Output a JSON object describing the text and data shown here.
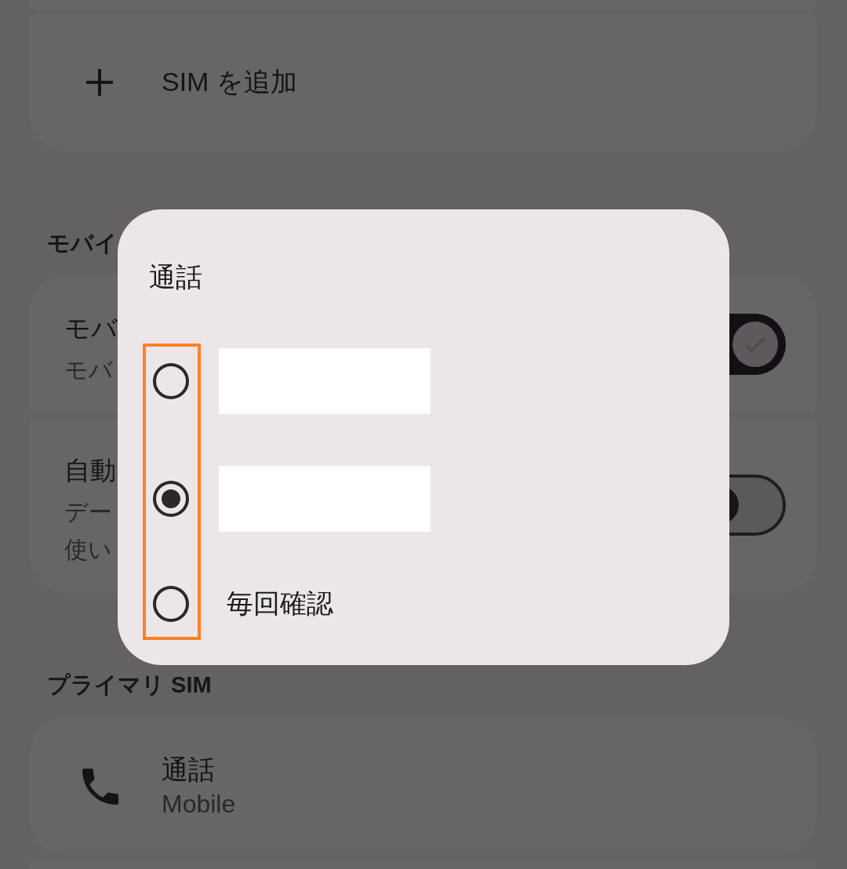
{
  "sections": [
    {
      "items": [
        {
          "kind": "add",
          "title": "SIM を追加"
        }
      ]
    },
    {
      "heading": "モバイ",
      "items": [
        {
          "kind": "switch",
          "title": "モバ",
          "subtitle_lines": [
            "モバ"
          ],
          "on": true
        },
        {
          "kind": "switch",
          "title": "自動",
          "subtitle_lines": [
            "デー",
            "使い"
          ],
          "on": false
        }
      ]
    },
    {
      "heading": "プライマリ SIM",
      "items": [
        {
          "kind": "entry",
          "title": "通話",
          "subtitle_lines": [
            "Mobile"
          ]
        }
      ]
    }
  ],
  "dialog": {
    "title": "通話",
    "radio_column_highlighted": true,
    "options": [
      {
        "kind": "redacted",
        "selected": false
      },
      {
        "kind": "redacted",
        "selected": true
      },
      {
        "kind": "text",
        "label": "毎回確認",
        "selected": false
      }
    ]
  }
}
